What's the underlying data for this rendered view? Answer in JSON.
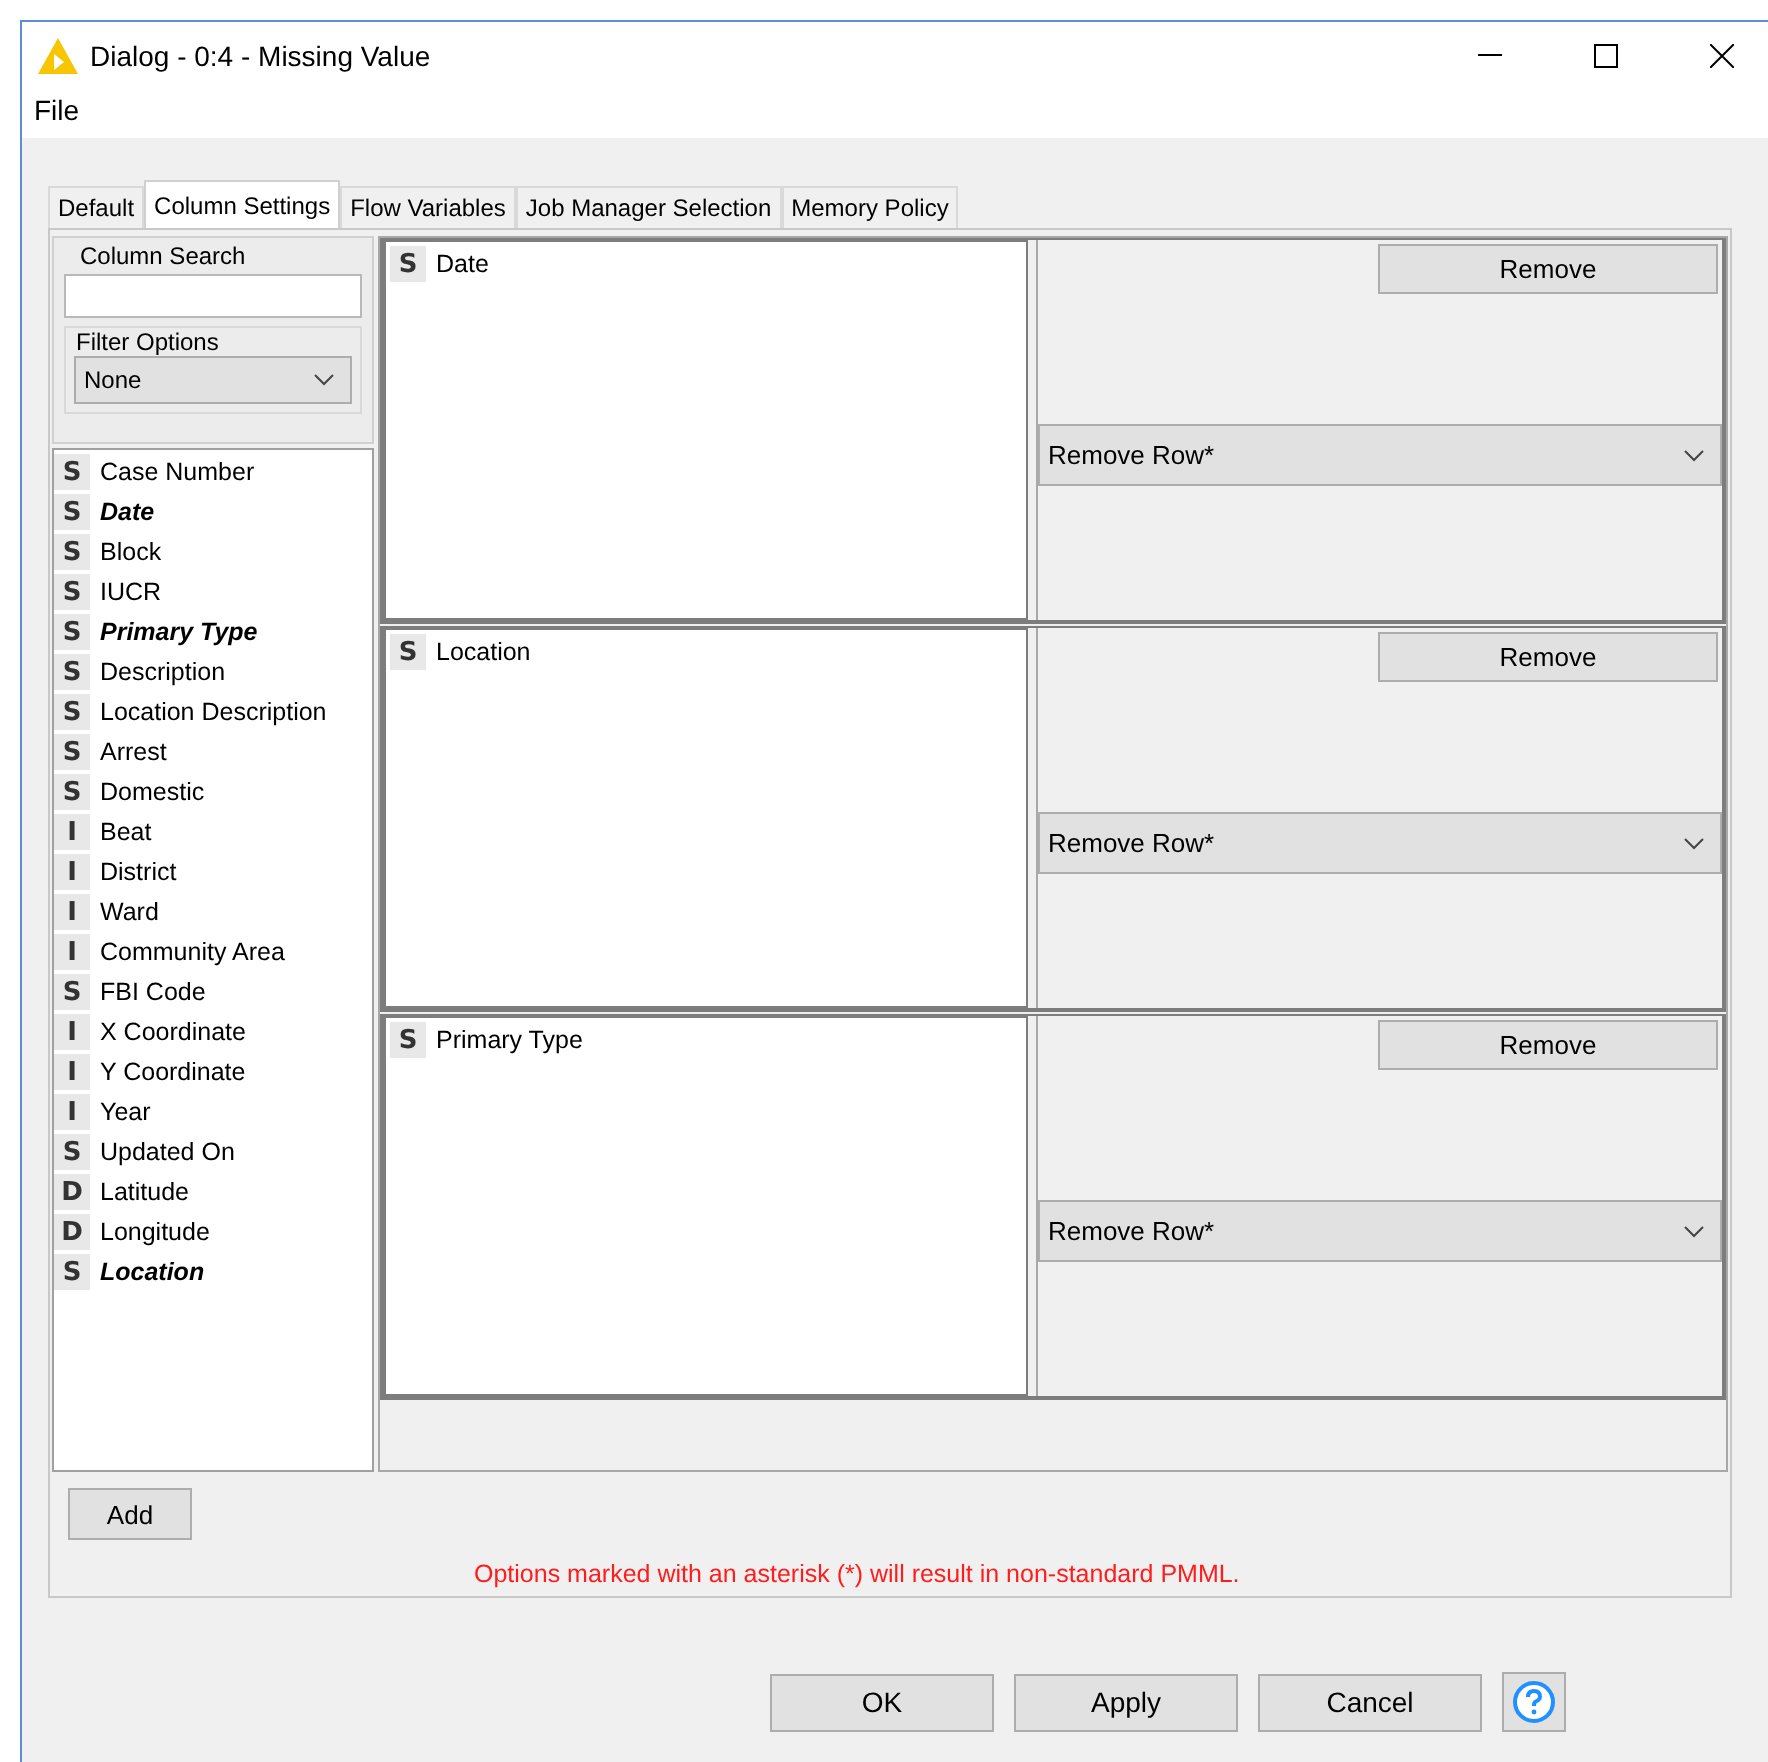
{
  "window": {
    "title": "Dialog - 0:4 - Missing Value"
  },
  "menu": [
    "File"
  ],
  "tabs": [
    {
      "label": "Default",
      "selected": false
    },
    {
      "label": "Column Settings",
      "selected": true
    },
    {
      "label": "Flow Variables",
      "selected": false
    },
    {
      "label": "Job Manager Selection",
      "selected": false
    },
    {
      "label": "Memory Policy",
      "selected": false
    }
  ],
  "column_search": {
    "label": "Column Search"
  },
  "filter_options": {
    "label": "Filter Options",
    "value": "None"
  },
  "columns": [
    {
      "type": "S",
      "name": "Case Number",
      "emphasized": false
    },
    {
      "type": "S",
      "name": "Date",
      "emphasized": true
    },
    {
      "type": "S",
      "name": "Block",
      "emphasized": false
    },
    {
      "type": "S",
      "name": "IUCR",
      "emphasized": false
    },
    {
      "type": "S",
      "name": "Primary Type",
      "emphasized": true
    },
    {
      "type": "S",
      "name": "Description",
      "emphasized": false
    },
    {
      "type": "S",
      "name": "Location Description",
      "emphasized": false
    },
    {
      "type": "S",
      "name": "Arrest",
      "emphasized": false
    },
    {
      "type": "S",
      "name": "Domestic",
      "emphasized": false
    },
    {
      "type": "I",
      "name": "Beat",
      "emphasized": false
    },
    {
      "type": "I",
      "name": "District",
      "emphasized": false
    },
    {
      "type": "I",
      "name": "Ward",
      "emphasized": false
    },
    {
      "type": "I",
      "name": "Community Area",
      "emphasized": false
    },
    {
      "type": "S",
      "name": "FBI Code",
      "emphasized": false
    },
    {
      "type": "I",
      "name": "X Coordinate",
      "emphasized": false
    },
    {
      "type": "I",
      "name": "Y Coordinate",
      "emphasized": false
    },
    {
      "type": "I",
      "name": "Year",
      "emphasized": false
    },
    {
      "type": "S",
      "name": "Updated On",
      "emphasized": false
    },
    {
      "type": "D",
      "name": "Latitude",
      "emphasized": false
    },
    {
      "type": "D",
      "name": "Longitude",
      "emphasized": false
    },
    {
      "type": "S",
      "name": "Location",
      "emphasized": true
    }
  ],
  "settings": [
    {
      "type": "S",
      "name": "Date",
      "button": "Remove",
      "method": "Remove Row*"
    },
    {
      "type": "S",
      "name": "Location",
      "button": "Remove",
      "method": "Remove Row*"
    },
    {
      "type": "S",
      "name": "Primary Type",
      "button": "Remove",
      "method": "Remove Row*"
    }
  ],
  "add_button": "Add",
  "note": "Options marked with an asterisk (*) will result in non-standard PMML.",
  "buttons": [
    "OK",
    "Apply",
    "Cancel"
  ]
}
